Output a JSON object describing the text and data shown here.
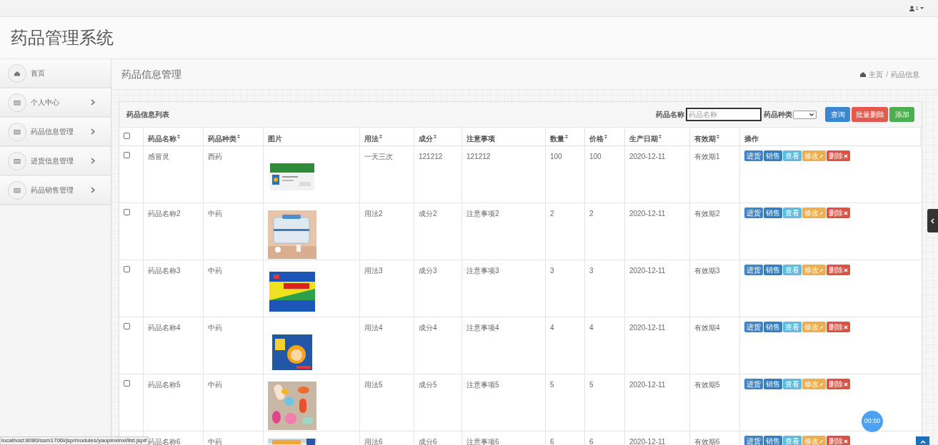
{
  "top_bar": {
    "user": "1"
  },
  "app_title": "药品管理系统",
  "sidebar": {
    "items": [
      {
        "label": "首页",
        "kind": "home",
        "expandable": false
      },
      {
        "label": "个人中心",
        "kind": "grid",
        "expandable": true
      },
      {
        "label": "药品信息管理",
        "kind": "grid",
        "expandable": true
      },
      {
        "label": "进货信息管理",
        "kind": "grid",
        "expandable": true
      },
      {
        "label": "药品销售管理",
        "kind": "grid",
        "expandable": true
      }
    ]
  },
  "page_title": "药品信息管理",
  "breadcrumb": {
    "separator": "/",
    "items": [
      "主页",
      "药品信息"
    ]
  },
  "panel": {
    "title": "药品信息列表",
    "search": {
      "name_label": "药品名称",
      "name_placeholder": "药品名称",
      "type_label": "药品种类"
    },
    "buttons": [
      {
        "label": "查询",
        "kind": "primary"
      },
      {
        "label": "批量删除",
        "kind": "danger"
      },
      {
        "label": "添加",
        "kind": "success"
      }
    ]
  },
  "table": {
    "select_all_checked": false,
    "columns": [
      {
        "label": "药品名称",
        "sortable": true
      },
      {
        "label": "药品种类",
        "sortable": true
      },
      {
        "label": "图片",
        "sortable": false
      },
      {
        "label": "用法",
        "sortable": true
      },
      {
        "label": "成分",
        "sortable": true
      },
      {
        "label": "注意事项",
        "sortable": false
      },
      {
        "label": "数量",
        "sortable": true
      },
      {
        "label": "价格",
        "sortable": true
      },
      {
        "label": "生产日期",
        "sortable": true
      },
      {
        "label": "有效期",
        "sortable": true
      },
      {
        "label": "操作",
        "sortable": false
      }
    ],
    "rows": [
      {
        "checked": false,
        "cells": [
          "感冒灵",
          "西药",
          "",
          "一天三次",
          "121212",
          "121212",
          "100",
          "100",
          "2020-12-11",
          "有效期1"
        ],
        "actions": [
          {
            "label": "进货",
            "kind": "stock"
          },
          {
            "label": "销售",
            "kind": "sell"
          },
          {
            "label": "查看",
            "kind": "view"
          },
          {
            "label": "修改",
            "kind": "edit"
          },
          {
            "label": "删除",
            "kind": "delete"
          }
        ]
      },
      {
        "checked": false,
        "cells": [
          "药品名称2",
          "中药",
          "",
          "用法2",
          "成分2",
          "注意事项2",
          "2",
          "2",
          "2020-12-11",
          "有效期2"
        ],
        "actions": [
          {
            "label": "进货",
            "kind": "stock"
          },
          {
            "label": "销售",
            "kind": "sell"
          },
          {
            "label": "查看",
            "kind": "view"
          },
          {
            "label": "修改",
            "kind": "edit"
          },
          {
            "label": "删除",
            "kind": "delete"
          }
        ]
      },
      {
        "checked": false,
        "cells": [
          "药品名称3",
          "中药",
          "",
          "用法3",
          "成分3",
          "注意事项3",
          "3",
          "3",
          "2020-12-11",
          "有效期3"
        ],
        "actions": [
          {
            "label": "进货",
            "kind": "stock"
          },
          {
            "label": "销售",
            "kind": "sell"
          },
          {
            "label": "查看",
            "kind": "view"
          },
          {
            "label": "修改",
            "kind": "edit"
          },
          {
            "label": "删除",
            "kind": "delete"
          }
        ]
      },
      {
        "checked": false,
        "cells": [
          "药品名称4",
          "中药",
          "",
          "用法4",
          "成分4",
          "注意事项4",
          "4",
          "4",
          "2020-12-11",
          "有效期4"
        ],
        "actions": [
          {
            "label": "进货",
            "kind": "stock"
          },
          {
            "label": "销售",
            "kind": "sell"
          },
          {
            "label": "查看",
            "kind": "view"
          },
          {
            "label": "修改",
            "kind": "edit"
          },
          {
            "label": "删除",
            "kind": "delete"
          }
        ]
      },
      {
        "checked": false,
        "cells": [
          "药品名称5",
          "中药",
          "",
          "用法5",
          "成分5",
          "注意事项5",
          "5",
          "5",
          "2020-12-11",
          "有效期5"
        ],
        "actions": [
          {
            "label": "进货",
            "kind": "stock"
          },
          {
            "label": "销售",
            "kind": "sell"
          },
          {
            "label": "查看",
            "kind": "view"
          },
          {
            "label": "修改",
            "kind": "edit"
          },
          {
            "label": "删除",
            "kind": "delete"
          }
        ]
      },
      {
        "cells": [
          "药品名称6",
          "中药",
          "",
          "用法6",
          "成分6",
          "注意事项6",
          "6",
          "6",
          "2020-12-11",
          "有效期6"
        ],
        "actions": [
          {
            "label": "进货",
            "kind": "stock"
          },
          {
            "label": "销售",
            "kind": "sell"
          },
          {
            "label": "查看",
            "kind": "view"
          },
          {
            "label": "修改",
            "kind": "edit"
          },
          {
            "label": "删除",
            "kind": "delete"
          }
        ]
      }
    ]
  },
  "timer_bubble": "00:50",
  "status_url": "localhost:8080/ssm1706l/jsp/modules/yaopinxinxi/list.jsp#"
}
